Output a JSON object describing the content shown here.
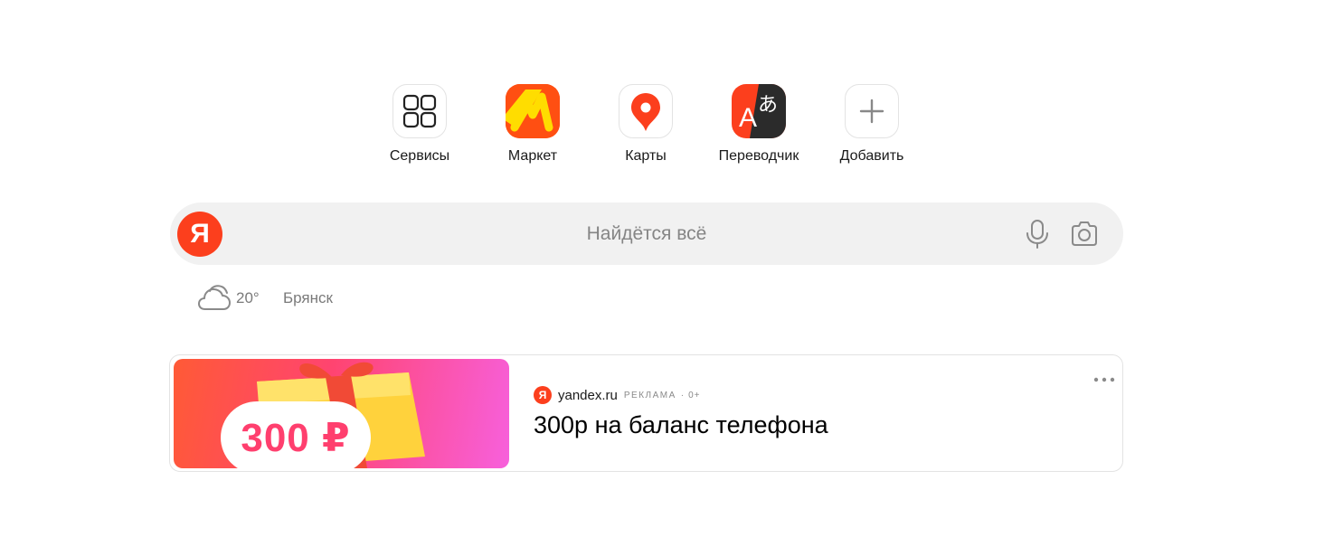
{
  "shortcuts": [
    {
      "label": "Сервисы",
      "icon": "services-grid-icon"
    },
    {
      "label": "Маркет",
      "icon": "market-logo-icon"
    },
    {
      "label": "Карты",
      "icon": "maps-pin-icon"
    },
    {
      "label": "Переводчик",
      "icon": "translator-icon"
    },
    {
      "label": "Добавить",
      "icon": "plus-icon"
    }
  ],
  "search": {
    "logo_letter": "Я",
    "placeholder": "Найдётся всё"
  },
  "weather": {
    "temperature": "20°",
    "city": "Брянск",
    "icon": "cloud-icon"
  },
  "ad": {
    "price": "300 ₽",
    "source_logo_letter": "Я",
    "domain": "yandex.ru",
    "tag": "РЕКЛАМА",
    "separator": "·",
    "age": "0+",
    "title": "300р на баланс телефона"
  },
  "colors": {
    "yandex_red": "#fc3f1d",
    "search_bg": "#f1f1f1",
    "market_yellow": "#ffdd00",
    "market_orange": "#ff4f12"
  }
}
